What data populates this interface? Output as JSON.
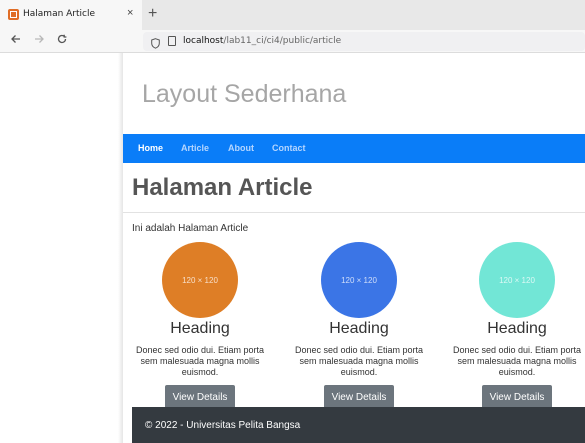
{
  "browser": {
    "tab_title": "Halaman Article",
    "tab_close": "×",
    "new_tab": "+",
    "url_host": "localhost",
    "url_path": "/lab11_ci/ci4/public/article"
  },
  "site": {
    "header_title": "Layout Sederhana",
    "nav": [
      {
        "label": "Home",
        "active": true
      },
      {
        "label": "Article",
        "active": false
      },
      {
        "label": "About",
        "active": false
      },
      {
        "label": "Contact",
        "active": false
      }
    ],
    "page_title": "Halaman Article",
    "intro": "Ini adalah Halaman Article",
    "cards": [
      {
        "placeholder": "120 × 120",
        "color": "#de7e26",
        "heading": "Heading",
        "text": "Donec sed odio dui. Etiam porta sem malesuada magna mollis euismod.",
        "button": "View Details"
      },
      {
        "placeholder": "120 × 120",
        "color": "#3b75e6",
        "heading": "Heading",
        "text": "Donec sed odio dui. Etiam porta sem malesuada magna mollis euismod.",
        "button": "View Details"
      },
      {
        "placeholder": "120 × 120",
        "color": "#72e6d6",
        "heading": "Heading",
        "text": "Donec sed odio dui. Etiam porta sem malesuada magna mollis euismod.",
        "button": "View Details"
      }
    ],
    "footer": "© 2022 - Universitas Pelita Bangsa"
  },
  "colors": {
    "navbar": "#0a7df8",
    "footer": "#343a40",
    "button": "#6c757d"
  },
  "icons": {
    "back": "back-arrow-icon",
    "forward": "forward-arrow-icon",
    "reload": "reload-icon",
    "shield": "shield-icon",
    "page": "page-icon"
  }
}
